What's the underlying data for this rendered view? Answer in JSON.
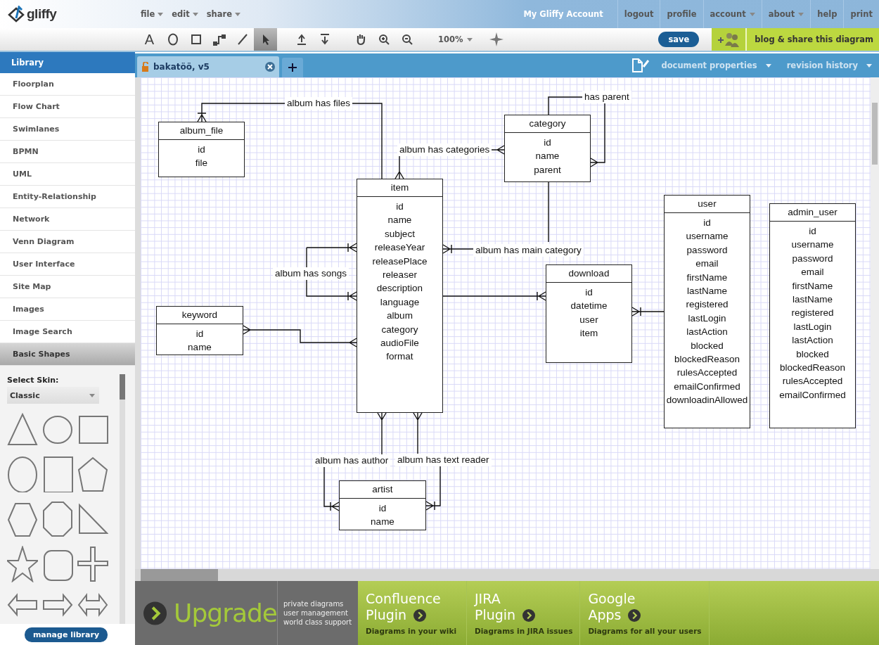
{
  "app": {
    "logo": "gliffy",
    "menus": [
      {
        "label": "file"
      },
      {
        "label": "edit"
      },
      {
        "label": "share"
      }
    ],
    "account": "My Gliffy Account",
    "account_links": [
      {
        "label": "logout",
        "dropdown": false
      },
      {
        "label": "profile",
        "dropdown": false
      },
      {
        "label": "account",
        "dropdown": true
      },
      {
        "label": "about",
        "dropdown": true
      },
      {
        "label": "help",
        "dropdown": false
      },
      {
        "label": "print",
        "dropdown": false
      }
    ]
  },
  "toolbar": {
    "tools": [
      {
        "kind": "text",
        "label": "A",
        "selected": false
      },
      {
        "kind": "ellipse",
        "selected": false
      },
      {
        "kind": "rectangle",
        "selected": false
      },
      {
        "kind": "connector",
        "selected": false
      },
      {
        "kind": "line",
        "selected": false
      },
      {
        "kind": "pointer",
        "selected": true
      },
      {
        "kind": "front",
        "selected": false
      },
      {
        "kind": "back",
        "selected": false
      },
      {
        "kind": "hand",
        "selected": false
      },
      {
        "kind": "zoom-in",
        "selected": false
      },
      {
        "kind": "zoom-out",
        "selected": false
      }
    ],
    "zoom": "100%",
    "save": "save",
    "share": "blog & share this diagram"
  },
  "sidebar": {
    "title": "Library",
    "items": [
      {
        "label": "Floorplan",
        "selected": false
      },
      {
        "label": "Flow Chart",
        "selected": false
      },
      {
        "label": "Swimlanes",
        "selected": false
      },
      {
        "label": "BPMN",
        "selected": false
      },
      {
        "label": "UML",
        "selected": false
      },
      {
        "label": "Entity-Relationship",
        "selected": false
      },
      {
        "label": "Network",
        "selected": false
      },
      {
        "label": "Venn Diagram",
        "selected": false
      },
      {
        "label": "User Interface",
        "selected": false
      },
      {
        "label": "Site Map",
        "selected": false
      },
      {
        "label": "Images",
        "selected": false
      },
      {
        "label": "Image Search",
        "selected": false
      },
      {
        "label": "Basic Shapes",
        "selected": true
      }
    ],
    "skin_label": "Select Skin:",
    "skin": "Classic",
    "manage": "manage library"
  },
  "tab": {
    "title": "bakatöö, v5",
    "document_properties": "document properties",
    "revision_history": "revision history"
  },
  "diagram": {
    "entities": [
      {
        "name": "album_file",
        "fields": [
          "id",
          "file"
        ]
      },
      {
        "name": "category",
        "fields": [
          "id",
          "name",
          "parent"
        ]
      },
      {
        "name": "item",
        "fields": [
          "id",
          "name",
          "subject",
          "releaseYear",
          "releasePlace",
          "releaser",
          "description",
          "language",
          "album",
          "category",
          "audioFile",
          "format"
        ]
      },
      {
        "name": "keyword",
        "fields": [
          "id",
          "name"
        ]
      },
      {
        "name": "download",
        "fields": [
          "id",
          "datetime",
          "user",
          "item"
        ]
      },
      {
        "name": "user",
        "fields": [
          "id",
          "username",
          "password",
          "email",
          "firstName",
          "lastName",
          "registered",
          "lastLogin",
          "lastAction",
          "blocked",
          "blockedReason",
          "rulesAccepted",
          "emailConfirmed",
          "downloadinAllowed"
        ]
      },
      {
        "name": "admin_user",
        "fields": [
          "id",
          "username",
          "password",
          "email",
          "firstName",
          "lastName",
          "registered",
          "lastLogin",
          "lastAction",
          "blocked",
          "blockedReason",
          "rulesAccepted",
          "emailConfirmed"
        ]
      },
      {
        "name": "artist",
        "fields": [
          "id",
          "name"
        ]
      }
    ],
    "relationships": [
      {
        "label": "album has files"
      },
      {
        "label": "has parent"
      },
      {
        "label": "album has categories"
      },
      {
        "label": "album has main category"
      },
      {
        "label": "album has songs"
      },
      {
        "label": "album has author"
      },
      {
        "label": "album has text reader"
      }
    ]
  },
  "banner": {
    "upgrade": "Upgrade",
    "features": [
      "private diagrams",
      "user management",
      "world class support"
    ],
    "plugins": [
      {
        "title_1": "Confluence",
        "title_2": "Plugin",
        "subtitle": "Diagrams in your wiki"
      },
      {
        "title_1": "JIRA",
        "title_2": "Plugin",
        "subtitle": "Diagrams in JIRA issues"
      },
      {
        "title_1": "Google",
        "title_2": "Apps",
        "subtitle": "Diagrams for all your users"
      }
    ]
  }
}
